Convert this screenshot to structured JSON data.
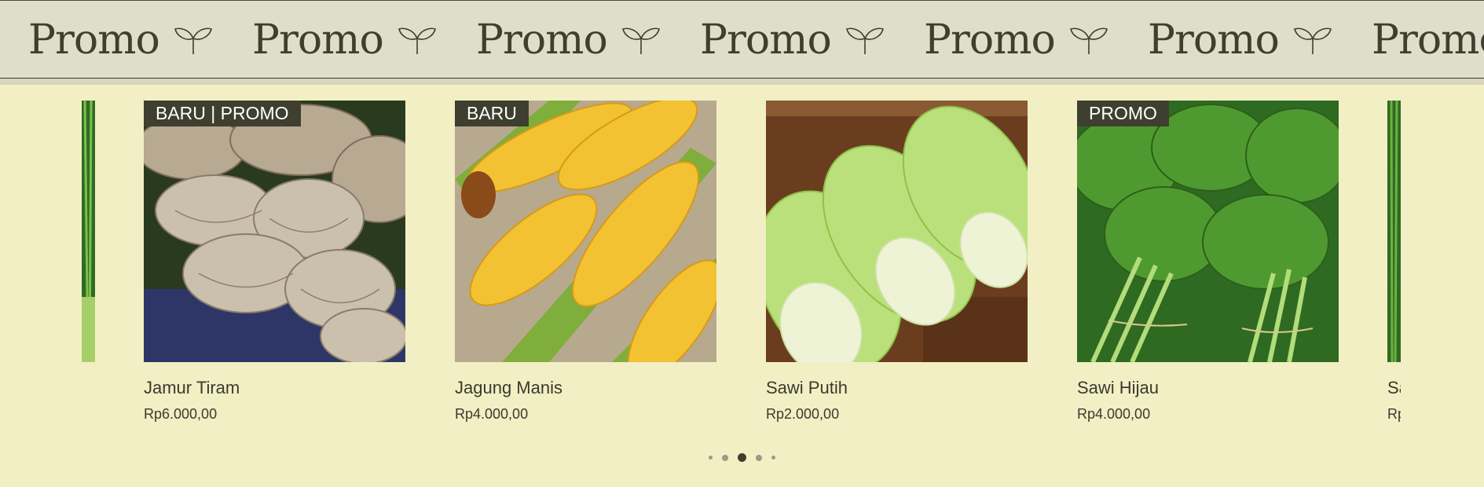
{
  "banner": {
    "word": "Promo",
    "repeat": 7,
    "icon": "sprout-icon"
  },
  "carousel": {
    "products": [
      {
        "name": "Jamur Tiram",
        "price": "Rp6.000,00",
        "badge": "BARU | PROMO",
        "image": "oyster-mushroom-photo"
      },
      {
        "name": "Jagung Manis",
        "price": "Rp4.000,00",
        "badge": "BARU",
        "image": "sweet-corn-photo"
      },
      {
        "name": "Sawi Putih",
        "price": "Rp2.000,00",
        "badge": "",
        "image": "napa-cabbage-photo"
      },
      {
        "name": "Sawi Hijau",
        "price": "Rp4.000,00",
        "badge": "PROMO",
        "image": "mustard-greens-photo"
      }
    ],
    "partial_next": {
      "name": "Sa",
      "price": "Rp"
    },
    "pagination": {
      "count": 5,
      "active": 3
    }
  },
  "colors": {
    "background": "#f2efc4",
    "banner": "#dedfcb",
    "ink": "#3f3f30"
  }
}
